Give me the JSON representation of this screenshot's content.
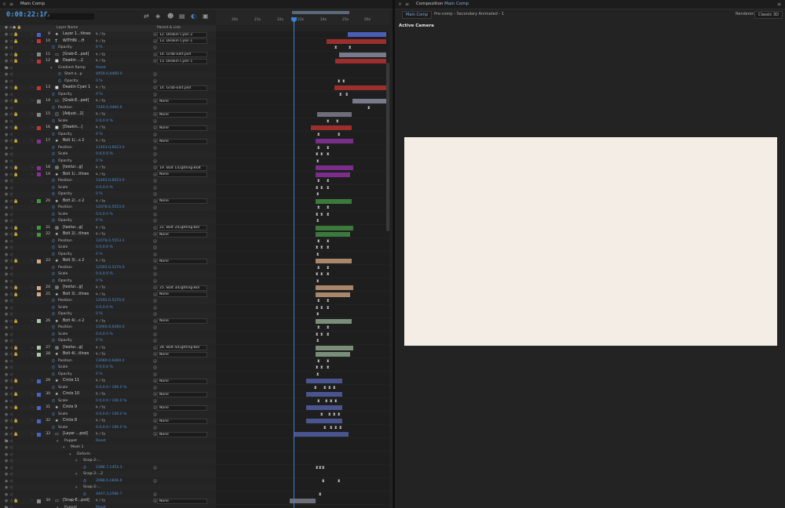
{
  "timeline": {
    "tab_title": "Main Comp",
    "timecode": "0:00:22:16",
    "frame_info": "",
    "columns": {
      "layer_name": "Layer Name",
      "parent_link": "Parent & Link"
    },
    "ruler_ticks": [
      "20s",
      "21s",
      "22s",
      "23s",
      "24s",
      "25s",
      "26s"
    ],
    "rows": [
      {
        "type": "layer",
        "num": "9",
        "name": "Layer 1...tlines",
        "label": "#4a63c8",
        "icon": "star",
        "parent": "12. Deakin Cyan 2",
        "bar": [
          443,
          492
        ],
        "bar_color": "#4a5fb8"
      },
      {
        "type": "layer",
        "num": "10",
        "name": "WITHIN ...H",
        "label": "#c83232",
        "icon": "text",
        "parent": "13. Deakin Cyan 1",
        "bar": [
          416,
          492
        ],
        "bar_color": "#9c2e2e"
      },
      {
        "type": "prop",
        "indent": 1,
        "name": "Opacity",
        "value": "0 %",
        "kf": [
          426,
          444
        ]
      },
      {
        "type": "layer",
        "num": "11",
        "name": "[Grab-E...psd]",
        "label": "#888888",
        "icon": "file",
        "parent": "14. Grab-Edit.psd",
        "bar": [
          432,
          492
        ],
        "bar_color": "#777a8a"
      },
      {
        "type": "layer",
        "num": "12",
        "name": "Deakin ...2",
        "label": "#c83232",
        "icon": "solid",
        "parent": "13. Deakin Cyan 1",
        "bar": [
          427,
          492
        ],
        "bar_color": "#9c2e2e"
      },
      {
        "type": "fx",
        "indent": 1,
        "name": "Gradient Ramp",
        "value": "Reset"
      },
      {
        "type": "prop",
        "indent": 2,
        "name": "Start o...p",
        "value": "4450.0,4460.0"
      },
      {
        "type": "prop",
        "indent": 2,
        "name": "Opacity",
        "value": "0 %",
        "kf": [
          430,
          436
        ]
      },
      {
        "type": "layer",
        "num": "13",
        "name": "Deakin Cyan 1",
        "label": "#c83232",
        "icon": "solid",
        "parent": "14. Grab-Edit.psd",
        "bar": [
          426,
          492
        ],
        "bar_color": "#9c2e2e"
      },
      {
        "type": "prop",
        "indent": 1,
        "name": "Opacity",
        "value": "0 %",
        "kf": [
          432,
          440
        ]
      },
      {
        "type": "layer",
        "num": "14",
        "name": "[Grab-E...psd]",
        "label": "#888888",
        "icon": "file",
        "parent": "None",
        "bar": [
          449,
          492
        ],
        "bar_color": "#777a8a"
      },
      {
        "type": "prop",
        "indent": 1,
        "name": "Position",
        "value": "7240.0,4460.0",
        "kf": [
          468
        ]
      },
      {
        "type": "layer",
        "num": "15",
        "name": "[Adjust...2]",
        "label": "#888888",
        "icon": "adj",
        "parent": "None",
        "bar": [
          404,
          448
        ],
        "bar_color": "#6e6e78"
      },
      {
        "type": "prop",
        "indent": 1,
        "name": "Scale",
        "value": "0.0,0.0 %",
        "kf": [
          416,
          428
        ]
      },
      {
        "type": "layer",
        "num": "16",
        "name": "[Deakin...]",
        "label": "#c83232",
        "icon": "solid",
        "parent": "None",
        "bar": [
          396,
          448
        ],
        "bar_color": "#9c2e2e"
      },
      {
        "type": "prop",
        "indent": 1,
        "name": "Opacity",
        "value": "0 %",
        "kf": [
          404,
          430
        ]
      },
      {
        "type": "layer",
        "num": "17",
        "name": "Bolt 1/...s 2",
        "label": "#8a2e9a",
        "icon": "star",
        "parent": "None",
        "bar": [
          402,
          450
        ],
        "bar_color": "#7a2e8a"
      },
      {
        "type": "prop",
        "indent": 1,
        "name": "Position",
        "value": "11403.0,6023.0",
        "kf": [
          404,
          416
        ]
      },
      {
        "type": "prop",
        "indent": 1,
        "name": "Scale",
        "value": "0.0,0.0 %",
        "kf": [
          402,
          408,
          416
        ]
      },
      {
        "type": "prop",
        "indent": 1,
        "name": "Opacity",
        "value": "0 %",
        "kf": [
          403
        ]
      },
      {
        "type": "layer",
        "num": "18",
        "name": "[textur...g]",
        "label": "#8a2e9a",
        "icon": "img",
        "parent": "19. Bolt 1/Lighting-Bolt",
        "bar": [
          402,
          450
        ],
        "bar_color": "#7a2e8a"
      },
      {
        "type": "layer",
        "num": "19",
        "name": "Bolt 1/...tlines",
        "label": "#8a2e9a",
        "icon": "star",
        "parent": "None",
        "bar": [
          402,
          446
        ],
        "bar_color": "#7a2e8a"
      },
      {
        "type": "prop",
        "indent": 1,
        "name": "Position",
        "value": "11403.0,6023.0",
        "kf": [
          404,
          416
        ]
      },
      {
        "type": "prop",
        "indent": 1,
        "name": "Scale",
        "value": "0.0,0.0 %",
        "kf": [
          402,
          408,
          416
        ]
      },
      {
        "type": "prop",
        "indent": 1,
        "name": "Opacity",
        "value": "0 %",
        "kf": [
          403
        ]
      },
      {
        "type": "layer",
        "num": "20",
        "name": "Bolt 2/...s 2",
        "label": "#3c9a3c",
        "icon": "star",
        "parent": "None",
        "bar": [
          402,
          448
        ],
        "bar_color": "#3c7a3c"
      },
      {
        "type": "prop",
        "indent": 1,
        "name": "Position",
        "value": "12078.0,5553.0",
        "kf": [
          404,
          416
        ]
      },
      {
        "type": "prop",
        "indent": 1,
        "name": "Scale",
        "value": "0.0,0.0 %",
        "kf": [
          402,
          408,
          416
        ]
      },
      {
        "type": "prop",
        "indent": 1,
        "name": "Opacity",
        "value": "0 %",
        "kf": [
          403
        ]
      },
      {
        "type": "layer",
        "num": "21",
        "name": "[textur...g]",
        "label": "#3c9a3c",
        "icon": "img",
        "parent": "22. Bolt 2/Lighting-Bol",
        "bar": [
          402,
          450
        ],
        "bar_color": "#3c7a3c"
      },
      {
        "type": "layer",
        "num": "22",
        "name": "Bolt 2/...tlines",
        "label": "#3c9a3c",
        "icon": "star",
        "parent": "None",
        "bar": [
          402,
          446
        ],
        "bar_color": "#3c7a3c"
      },
      {
        "type": "prop",
        "indent": 1,
        "name": "Position",
        "value": "12078.0,5553.0",
        "kf": [
          404,
          416
        ]
      },
      {
        "type": "prop",
        "indent": 1,
        "name": "Scale",
        "value": "0.0,0.0 %",
        "kf": [
          402,
          408,
          416
        ]
      },
      {
        "type": "prop",
        "indent": 1,
        "name": "Opacity",
        "value": "0 %",
        "kf": [
          403
        ]
      },
      {
        "type": "layer",
        "num": "23",
        "name": "Bolt 3/...s 2",
        "label": "#d8a880",
        "icon": "star",
        "parent": "None",
        "bar": [
          402,
          448
        ],
        "bar_color": "#a8876a"
      },
      {
        "type": "prop",
        "indent": 1,
        "name": "Position",
        "value": "12592.0,5270.0",
        "kf": [
          404,
          416
        ]
      },
      {
        "type": "prop",
        "indent": 1,
        "name": "Scale",
        "value": "0.0,0.0 %",
        "kf": [
          402,
          408,
          416
        ]
      },
      {
        "type": "prop",
        "indent": 1,
        "name": "Opacity",
        "value": "0 %",
        "kf": [
          403
        ]
      },
      {
        "type": "layer",
        "num": "24",
        "name": "[textur...g]",
        "label": "#d8a880",
        "icon": "img",
        "parent": "25. Bolt 3/Lighting-Bol",
        "bar": [
          402,
          450
        ],
        "bar_color": "#a8876a"
      },
      {
        "type": "layer",
        "num": "25",
        "name": "Bolt 3/...tlines",
        "label": "#d8a880",
        "icon": "star",
        "parent": "None",
        "bar": [
          402,
          446
        ],
        "bar_color": "#a8876a"
      },
      {
        "type": "prop",
        "indent": 1,
        "name": "Position",
        "value": "12592.0,5270.0",
        "kf": [
          404,
          416
        ]
      },
      {
        "type": "prop",
        "indent": 1,
        "name": "Scale",
        "value": "0.0,0.0 %",
        "kf": [
          402,
          408,
          416
        ]
      },
      {
        "type": "prop",
        "indent": 1,
        "name": "Opacity",
        "value": "0 %",
        "kf": [
          403
        ]
      },
      {
        "type": "layer",
        "num": "26",
        "name": "Bolt 4/...s 2",
        "label": "#a8c8a8",
        "icon": "star",
        "parent": "None",
        "bar": [
          402,
          448
        ],
        "bar_color": "#7a8e7a"
      },
      {
        "type": "prop",
        "indent": 1,
        "name": "Position",
        "value": "13069.0,6460.0",
        "kf": [
          404,
          416
        ]
      },
      {
        "type": "prop",
        "indent": 1,
        "name": "Scale",
        "value": "0.0,0.0 %",
        "kf": [
          402,
          408,
          416
        ]
      },
      {
        "type": "prop",
        "indent": 1,
        "name": "Opacity",
        "value": "0 %",
        "kf": [
          403
        ]
      },
      {
        "type": "layer",
        "num": "27",
        "name": "[textur...g]",
        "label": "#a8c8a8",
        "icon": "img",
        "parent": "28. Bolt 4/Lighting-Bol",
        "bar": [
          402,
          450
        ],
        "bar_color": "#7a8e7a"
      },
      {
        "type": "layer",
        "num": "28",
        "name": "Bolt 4/...tlines",
        "label": "#a8c8a8",
        "icon": "star",
        "parent": "None",
        "bar": [
          402,
          446
        ],
        "bar_color": "#7a8e7a"
      },
      {
        "type": "prop",
        "indent": 1,
        "name": "Position",
        "value": "13069.0,6460.0",
        "kf": [
          404,
          416
        ]
      },
      {
        "type": "prop",
        "indent": 1,
        "name": "Scale",
        "value": "0.0,0.0 %",
        "kf": [
          402,
          408,
          416
        ]
      },
      {
        "type": "prop",
        "indent": 1,
        "name": "Opacity",
        "value": "0 %",
        "kf": [
          403
        ]
      },
      {
        "type": "layer",
        "num": "29",
        "name": "Circle 11",
        "label": "#4a63c8",
        "icon": "star",
        "parent": "None",
        "bar": [
          390,
          436
        ],
        "bar_color": "#4a5590"
      },
      {
        "type": "prop",
        "indent": 1,
        "name": "Scale",
        "value": "0.0,0.0 / 100.0 %",
        "kf": [
          400,
          412,
          418,
          424
        ]
      },
      {
        "type": "layer",
        "num": "30",
        "name": "Circle 10",
        "label": "#4a63c8",
        "icon": "star",
        "parent": "None",
        "bar": [
          390,
          436
        ],
        "bar_color": "#4a5590"
      },
      {
        "type": "prop",
        "indent": 1,
        "name": "Scale",
        "value": "0.0,0.0 / 100.0 %",
        "kf": [
          404,
          414,
          420,
          426
        ]
      },
      {
        "type": "layer",
        "num": "31",
        "name": "Circle 9",
        "label": "#4a63c8",
        "icon": "star",
        "parent": "None",
        "bar": [
          390,
          436
        ],
        "bar_color": "#4a5590"
      },
      {
        "type": "prop",
        "indent": 1,
        "name": "Scale",
        "value": "0.0,0.0 / 100.0 %",
        "kf": [
          408,
          418,
          424,
          430
        ]
      },
      {
        "type": "layer",
        "num": "32",
        "name": "Circle 8",
        "label": "#4a63c8",
        "icon": "star",
        "parent": "None",
        "bar": [
          390,
          436
        ],
        "bar_color": "#4a5590"
      },
      {
        "type": "prop",
        "indent": 1,
        "name": "Scale",
        "value": "0.0,0.0 / 100.0 %",
        "kf": [
          412,
          420,
          426,
          432
        ]
      },
      {
        "type": "layer",
        "num": "33",
        "name": "[Layer ...psd]",
        "label": "#4a63c8",
        "icon": "file",
        "parent": "None",
        "bar": [
          374,
          444
        ],
        "bar_color": "#4a5590"
      },
      {
        "type": "fx",
        "indent": 2,
        "name": "Puppet",
        "value": "Reset"
      },
      {
        "type": "group",
        "indent": 3,
        "name": "Mesh 1"
      },
      {
        "type": "group",
        "indent": 4,
        "name": "Deform"
      },
      {
        "type": "group",
        "indent": 5,
        "name": "Snap-2-..."
      },
      {
        "type": "prop",
        "indent": 6,
        "name": "",
        "value": "2386.7,1453.3",
        "kf": [
          402,
          406,
          410
        ]
      },
      {
        "type": "group",
        "indent": 5,
        "name": "Snap-2-...2"
      },
      {
        "type": "prop",
        "indent": 6,
        "name": "",
        "value": "2088.0,1846.0",
        "kf": [
          410,
          430
        ]
      },
      {
        "type": "group",
        "indent": 5,
        "name": "Snap-2-..."
      },
      {
        "type": "prop",
        "indent": 6,
        "name": "",
        "value": "4467.3,2586.7",
        "kf": [
          406
        ]
      },
      {
        "type": "layer",
        "num": "34",
        "name": "[Snap-E...psd]",
        "label": "#888888",
        "icon": "file",
        "parent": "None",
        "bar": [
          369,
          402
        ],
        "bar_color": "#6e6e78"
      },
      {
        "type": "fx",
        "indent": 2,
        "name": "Puppet",
        "value": "Reset"
      }
    ]
  },
  "composition": {
    "tab_title": "Composition",
    "tab_comp": "Main Comp",
    "pill": "Main Comp",
    "breadcrumb": "Pre-comp - Secondary Animated - 1",
    "renderer_label": "Renderer:",
    "renderer_value": "Classic 3D",
    "camera_label": "Active Camera",
    "viewer_color": "#f3ede6"
  }
}
